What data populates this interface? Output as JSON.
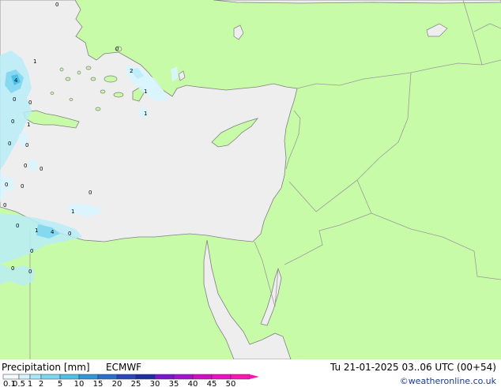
{
  "title": "Precipitation [mm]",
  "model": "ECMWF",
  "valid_time": "Tu 21-01-2025 03..06 UTC (00+54)",
  "credit": "©weatheronline.co.uk",
  "colors": {
    "land": "#c8fba8",
    "sea": "#eeeeee",
    "border": "#9a9a9a",
    "coast": "#808080"
  },
  "legend": {
    "ticks": [
      "0.1",
      "0.5",
      "1",
      "2",
      "5",
      "10",
      "15",
      "20",
      "25",
      "30",
      "35",
      "40",
      "45",
      "50"
    ],
    "colors": [
      "#f2fbff",
      "#d6f4ff",
      "#a8e8fa",
      "#7ad8f0",
      "#4fc0e6",
      "#2f96d8",
      "#2a6fd0",
      "#2a45bf",
      "#1c2ea6",
      "#7a18c8",
      "#a314cc",
      "#cc10c8",
      "#e814c4",
      "#f418b4"
    ]
  },
  "map_labels": [
    "0",
    "0",
    "1",
    "2",
    "1",
    "1",
    "4",
    "0",
    "0",
    "1",
    "0",
    "0",
    "0",
    "0",
    "0",
    "0",
    "1",
    "0",
    "0",
    "0",
    "1",
    "4",
    "0",
    "0",
    "0",
    "0",
    "0"
  ]
}
